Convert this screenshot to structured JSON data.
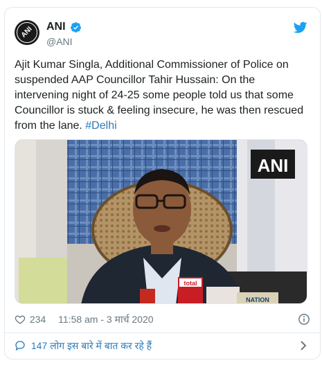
{
  "tweet": {
    "display_name": "ANI",
    "handle": "@ANI",
    "avatar_text": "ANI",
    "text": "Ajit Kumar Singla, Additional Commissioner of Police on suspended AAP Councillor Tahir Hussain: On the intervening night of 24-25 some people told us that some Councillor is stuck & feeling insecure, he was then rescued from the lane.",
    "hashtag": "#Delhi",
    "media_watermark": "ANI",
    "mic_label_1": "total",
    "mic_label_2": "NATION",
    "likes": "234",
    "timestamp": "11:58 am - 3 मार्च 2020",
    "conversation": "147 लोग इस बारे में बात कर रहे हैं"
  },
  "colors": {
    "link": "#2b7bb9",
    "twitter_blue": "#1da1f2",
    "muted": "#697882",
    "border": "#e1e8ed"
  },
  "icons": [
    "avatar",
    "verified-badge-icon",
    "twitter-bird-icon",
    "heart-icon",
    "info-icon",
    "speech-bubble-icon",
    "chevron-right-icon"
  ]
}
